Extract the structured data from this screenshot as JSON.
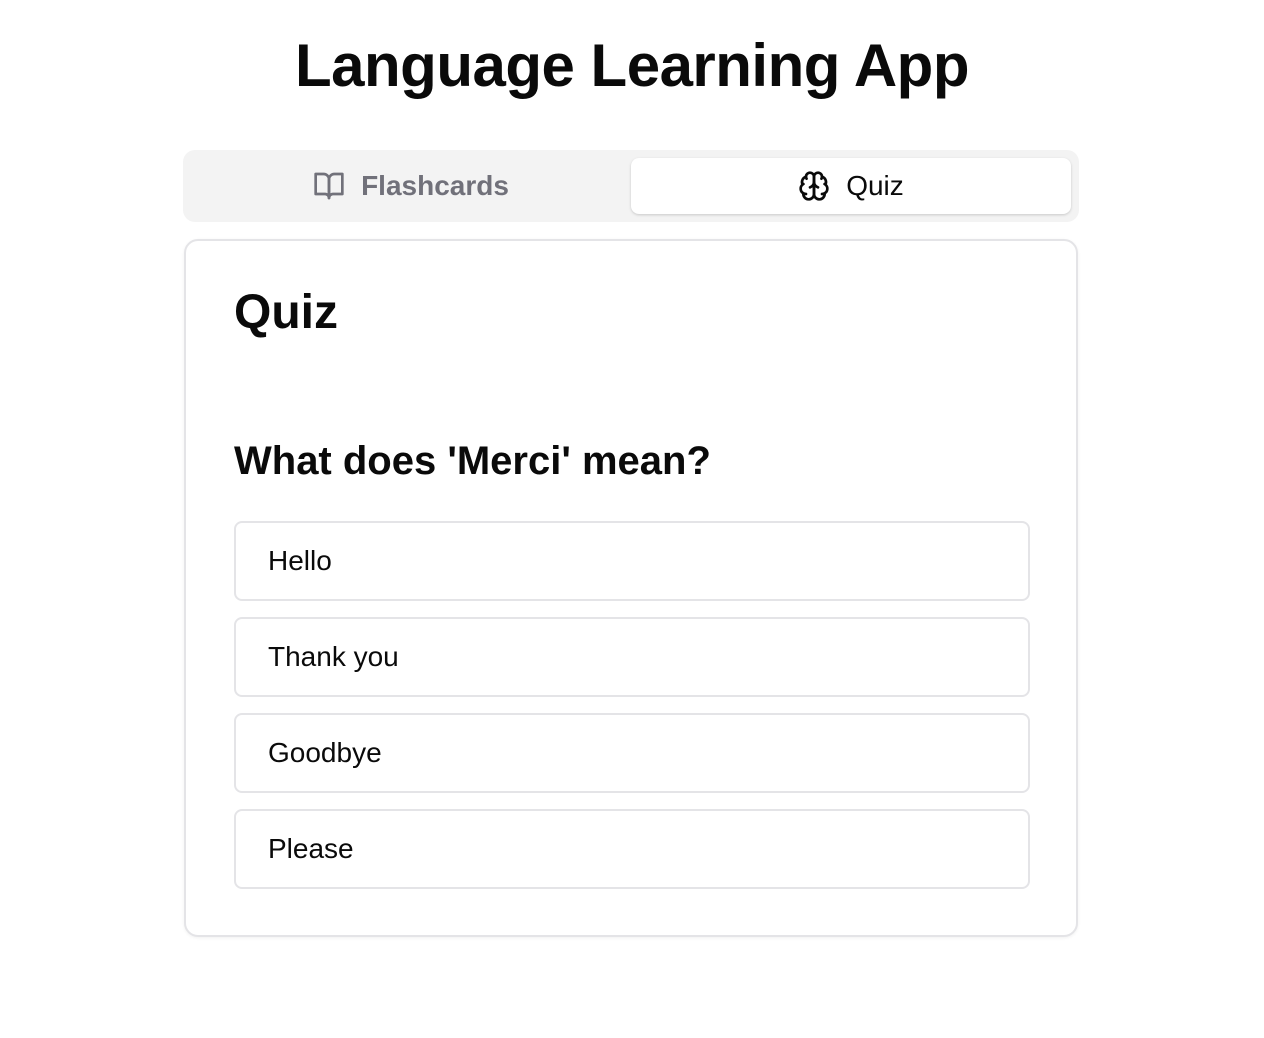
{
  "app": {
    "title": "Language Learning App"
  },
  "tabs": [
    {
      "label": "Flashcards",
      "icon": "book-open-icon",
      "active": false
    },
    {
      "label": "Quiz",
      "icon": "brain-icon",
      "active": true
    }
  ],
  "quiz": {
    "title": "Quiz",
    "question": "What does 'Merci' mean?",
    "options": [
      "Hello",
      "Thank you",
      "Goodbye",
      "Please"
    ]
  },
  "colors": {
    "tab_list_bg": "#f3f3f3",
    "inactive_tab_text": "#71717a",
    "border": "#e4e4e7",
    "text": "#0a0a0a"
  }
}
